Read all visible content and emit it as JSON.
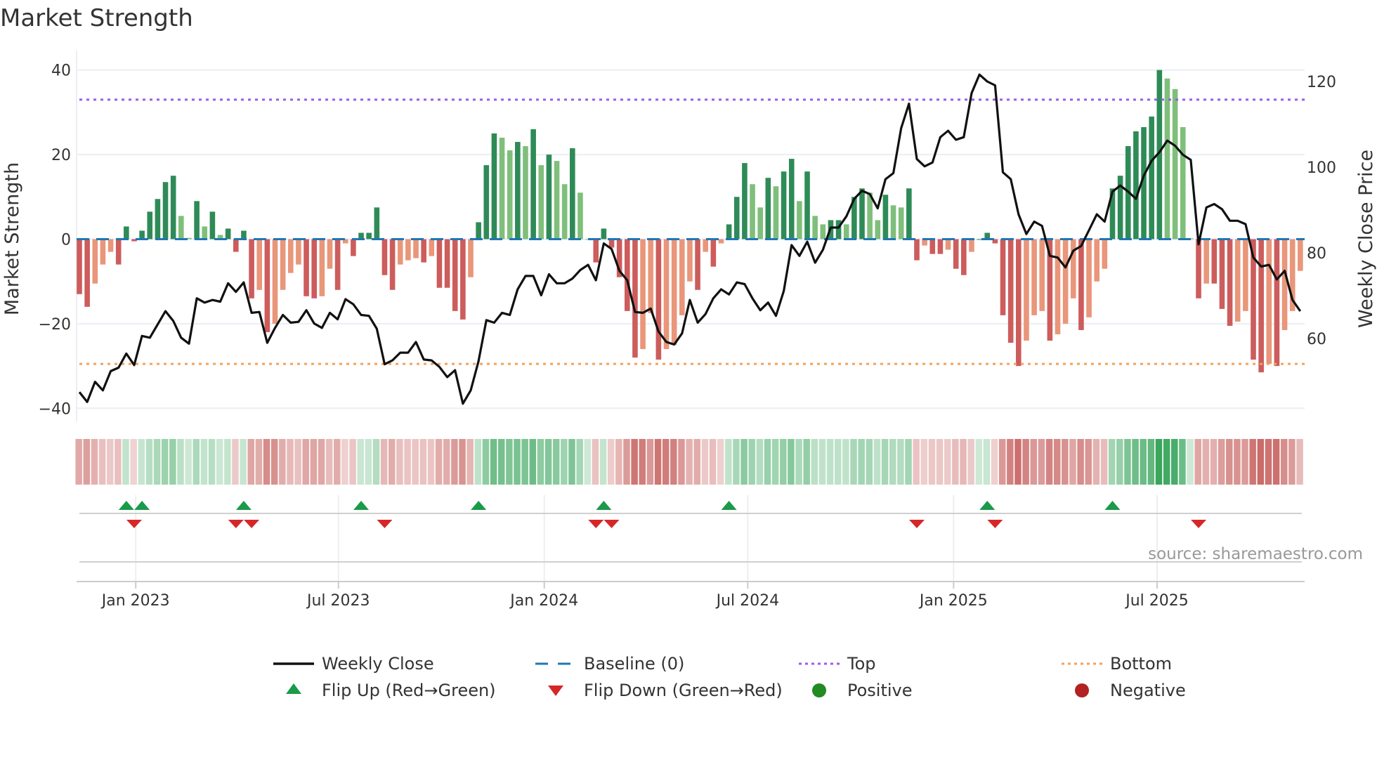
{
  "title": "Market Strength",
  "source": "source: sharemaestro.com",
  "chart_data": {
    "type": "bar",
    "title": "Market Strength",
    "ylabel": "Market Strength",
    "y2label": "Weekly Close Price",
    "ylim": [
      -43,
      42
    ],
    "y2lim": [
      43,
      124
    ],
    "yticks": [
      "40",
      "20",
      "0",
      "−20",
      "−40"
    ],
    "ytick_values": [
      40,
      20,
      0,
      -20,
      -40
    ],
    "y2ticks": [
      "120",
      "100",
      "80",
      "60"
    ],
    "y2tick_values": [
      120,
      100,
      80,
      60
    ],
    "start_date": "2022-11-11",
    "x_unit": "week index from start_date",
    "xticks": [
      {
        "label": "Jan 2023",
        "week": 7.2
      },
      {
        "label": "Jul 2023",
        "week": 33.1
      },
      {
        "label": "Jan 2024",
        "week": 59.4
      },
      {
        "label": "Jul 2024",
        "week": 85.4
      },
      {
        "label": "Jan 2025",
        "week": 111.7
      },
      {
        "label": "Jul 2025",
        "week": 137.7
      }
    ],
    "top_level": 33,
    "bottom_level": -29.5,
    "baseline": 0,
    "strength": [
      -13,
      -16,
      -10.5,
      -6,
      -3,
      -6,
      3,
      -0.5,
      2,
      6.5,
      9.5,
      13.5,
      15,
      5.5,
      0.3,
      9,
      3,
      6.5,
      1,
      2.5,
      -3,
      2,
      -14,
      -12,
      -22,
      -20,
      -12,
      -8,
      -6,
      -13.5,
      -14,
      -13.5,
      -7,
      -12,
      -1,
      -4,
      1.5,
      1.5,
      7.5,
      -8.5,
      -12,
      -6,
      -5,
      -4.5,
      -5.5,
      -4,
      -11.5,
      -11.5,
      -17,
      -19,
      -9,
      4,
      17.5,
      25,
      24,
      21,
      23,
      22,
      26,
      17.5,
      20,
      18.5,
      13,
      21.5,
      11,
      0,
      -5.5,
      2.5,
      -2,
      -9,
      -17,
      -28,
      -26,
      -17.5,
      -28.5,
      -26,
      -25,
      -18,
      -10,
      -12,
      -3,
      -6.5,
      -1,
      3.5,
      10,
      18,
      13,
      7.5,
      14.5,
      12.5,
      16,
      19,
      9,
      16,
      5.5,
      3.5,
      4.5,
      4.5,
      3.5,
      10,
      12,
      11,
      4.5,
      10.5,
      8,
      7.5,
      12,
      -5,
      -1.5,
      -3.5,
      -3.5,
      -2.5,
      -7,
      -8.5,
      -3,
      0,
      1.5,
      -1,
      -18,
      -24.5,
      -30,
      -24,
      -18,
      -17,
      -24,
      -22.5,
      -20,
      -14,
      -21.5,
      -18.5,
      -10,
      -7,
      12,
      15,
      22,
      25.5,
      26.5,
      29,
      40,
      38,
      35.5,
      26.5,
      0.2,
      -14,
      -10.5,
      -10.5,
      -16.5,
      -20.5,
      -19.5,
      -17,
      -28.5,
      -31.5,
      -29.5,
      -30,
      -21.5,
      -17,
      -7.5
    ],
    "weekly_close": [
      47.5,
      45.2,
      49.9,
      47.9,
      52.4,
      53.2,
      56.5,
      53.8,
      60.6,
      60.2,
      63.3,
      66.4,
      64.1,
      60.2,
      58.8,
      69.4,
      68.4,
      69.0,
      68.6,
      72.9,
      70.9,
      73.1,
      66.0,
      66.2,
      59.0,
      62.5,
      65.5,
      63.7,
      63.9,
      66.6,
      63.5,
      62.5,
      66.0,
      64.5,
      69.2,
      68.0,
      65.5,
      65.3,
      62.3,
      54.0,
      54.9,
      56.7,
      56.7,
      59.2,
      55.1,
      54.9,
      53.4,
      51.0,
      52.6,
      44.8,
      47.9,
      54.7,
      64.3,
      63.7,
      66.0,
      65.5,
      71.5,
      74.6,
      74.6,
      70.1,
      75.0,
      72.9,
      72.9,
      74.0,
      76.0,
      77.2,
      73.6,
      82.2,
      80.9,
      75.8,
      73.6,
      66.2,
      66.0,
      67.0,
      61.6,
      59.2,
      58.6,
      61.2,
      69.0,
      63.7,
      65.7,
      69.4,
      71.5,
      70.3,
      73.1,
      72.7,
      69.4,
      66.6,
      68.4,
      65.3,
      71.1,
      81.8,
      79.3,
      82.6,
      77.7,
      80.7,
      85.9,
      85.9,
      88.5,
      92.6,
      94.5,
      93.7,
      90.4,
      97.2,
      98.6,
      109.1,
      114.8,
      101.9,
      100.2,
      101.1,
      107.0,
      108.5,
      106.4,
      107.0,
      117.3,
      121.6,
      120.0,
      119.1,
      98.8,
      97.2,
      89.0,
      84.4,
      87.3,
      86.3,
      79.3,
      78.9,
      76.6,
      80.5,
      81.6,
      85.3,
      89.0,
      87.3,
      94.3,
      95.7,
      94.3,
      92.6,
      98.0,
      101.5,
      103.5,
      106.2,
      105.0,
      102.9,
      101.7,
      82.0,
      90.6,
      91.4,
      90.2,
      87.5,
      87.5,
      86.7,
      78.9,
      76.8,
      77.2,
      73.8,
      75.8,
      69.0,
      66.4
    ],
    "flip_up_weeks": [
      6,
      8,
      21,
      36,
      51,
      67,
      83,
      116,
      132
    ],
    "flip_down_weeks": [
      7,
      20,
      22,
      39,
      66,
      68,
      107,
      117,
      143
    ],
    "legend": {
      "placement": "bottom",
      "items": [
        {
          "label": "Weekly Close",
          "key": "line"
        },
        {
          "label": "Baseline (0)",
          "key": "baseline"
        },
        {
          "label": "Top",
          "key": "top"
        },
        {
          "label": "Bottom",
          "key": "bottom"
        },
        {
          "label": "Flip Up (Red→Green)",
          "key": "flip_up"
        },
        {
          "label": "Flip Down (Green→Red)",
          "key": "flip_down"
        },
        {
          "label": "Positive",
          "key": "positive"
        },
        {
          "label": "Negative",
          "key": "negative"
        }
      ]
    }
  },
  "colors": {
    "pos_strong": "#2e8b57",
    "pos_weak": "#7fbf7b",
    "neg_strong": "#cd5c5c",
    "neg_weak": "#e9967a",
    "line": "#111111",
    "baseline": "#1f77b4",
    "top": "#9b5de5",
    "bottom": "#f4a259",
    "flip_up": "#1a9a4a",
    "flip_down": "#d62728",
    "positive": "#228b22",
    "negative": "#b22222",
    "grid": "#eceef5",
    "axis": "#cccccc"
  }
}
